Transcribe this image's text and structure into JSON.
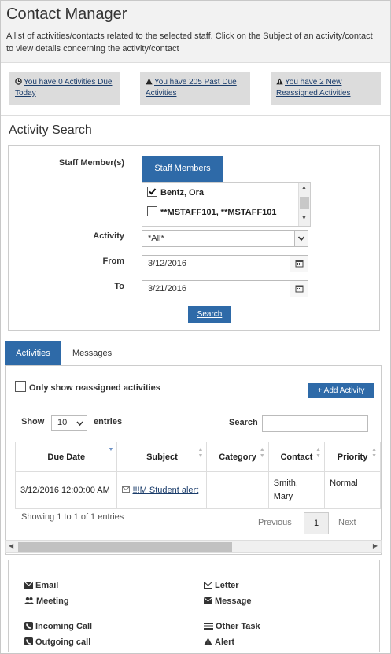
{
  "header": {
    "title": "Contact Manager",
    "description": "A list of activities/contacts related to the selected staff. Click on the Subject of an activity/contact to view details concerning the activity/contact"
  },
  "alerts": [
    {
      "icon": "clock-icon",
      "text": "You have 0 Activities Due Today"
    },
    {
      "icon": "warning-icon",
      "text": "You have 205 Past Due Activities"
    },
    {
      "icon": "warning-icon",
      "text": "You have 2 New Reassigned Activities"
    }
  ],
  "search": {
    "title": "Activity Search",
    "staff_label": "Staff Member(s)",
    "staff_tab": "Staff Members",
    "staff_list": [
      {
        "name": "Bentz, Ora",
        "checked": true
      },
      {
        "name": "**MSTAFF101, **MSTAFF101",
        "checked": false
      }
    ],
    "activity_label": "Activity",
    "activity_value": "*All*",
    "from_label": "From",
    "from_value": "3/12/2016",
    "to_label": "To",
    "to_value": "3/21/2016",
    "search_button": "Search"
  },
  "tabs": {
    "activities": "Activities",
    "messages": "Messages"
  },
  "activities": {
    "reassigned_label": "Only show reassigned activities",
    "add_button": "+ Add Activity",
    "show_label": "Show",
    "entries_value": "10",
    "entries_label": "entries",
    "search_label": "Search",
    "columns": [
      "Due Date",
      "Subject",
      "Category",
      "Contact",
      "Priority"
    ],
    "rows": [
      {
        "due_date": "3/12/2016 12:00:00 AM",
        "subject": "!!!M Student alert",
        "category": "",
        "contact": "Smith, Mary",
        "priority": "Normal"
      }
    ],
    "info": "Showing 1 to 1 of 1 entries",
    "previous": "Previous",
    "page": "1",
    "next": "Next"
  },
  "legend": [
    {
      "icon": "email-icon",
      "label": "Email"
    },
    {
      "icon": "letter-icon",
      "label": "Letter"
    },
    {
      "icon": "meeting-icon",
      "label": "Meeting"
    },
    {
      "icon": "message-icon",
      "label": "Message"
    },
    {
      "icon": "incoming-call-icon",
      "label": "Incoming Call"
    },
    {
      "icon": "other-task-icon",
      "label": "Other Task"
    },
    {
      "icon": "outgoing-call-icon",
      "label": "Outgoing call"
    },
    {
      "icon": "alert-icon",
      "label": "Alert"
    }
  ],
  "colors": {
    "accent": "#2e6aa8",
    "header_bg": "#f2f2f2",
    "alert_bg": "#dcdcdc"
  }
}
